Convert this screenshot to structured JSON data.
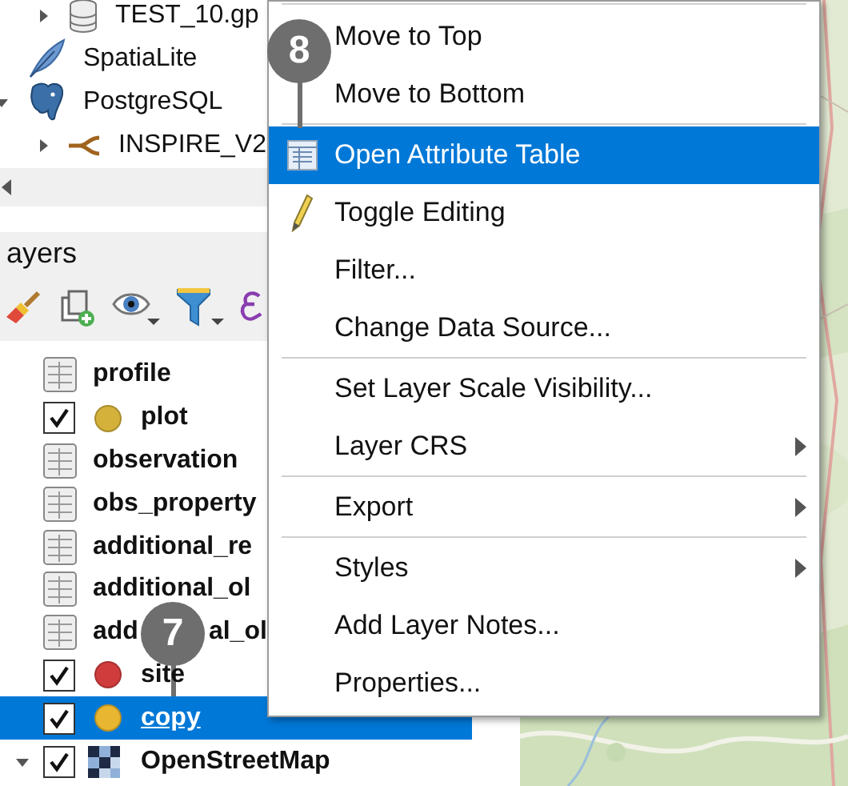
{
  "browser": {
    "continued_children": [
      {
        "label": "TEST_10.gp",
        "kind": "geopackage",
        "expanded": false
      }
    ],
    "items": [
      {
        "label": "SpatiaLite",
        "kind": "spatialite"
      },
      {
        "label": "PostgreSQL",
        "kind": "postgres",
        "expanded": true,
        "children": [
          {
            "label": "INSPIRE_V2",
            "kind": "schema",
            "expanded": false
          }
        ]
      }
    ]
  },
  "layers_panel": {
    "title": "ayers",
    "layers": [
      {
        "label": "profile",
        "kind": "table",
        "selected": false
      },
      {
        "label": "plot",
        "kind": "point",
        "checked": true,
        "color": "#d4b13a",
        "selected": false
      },
      {
        "label": "observation",
        "kind": "table",
        "selected": false
      },
      {
        "label": "obs_property",
        "kind": "table",
        "selected": false
      },
      {
        "label": "additional_re",
        "kind": "table",
        "selected": false
      },
      {
        "label": "additional_ol",
        "kind": "table",
        "selected": false
      },
      {
        "label": "add",
        "label_after_callout": "al_ol",
        "kind": "table",
        "selected": false
      },
      {
        "label": "site",
        "kind": "point",
        "checked": true,
        "color": "#d03c3c",
        "selected": false
      },
      {
        "label": "copy",
        "kind": "point",
        "checked": true,
        "color": "#e8b630",
        "selected": true
      },
      {
        "label": "OpenStreetMap",
        "kind": "raster",
        "checked": true,
        "expanded": true,
        "selected": false
      }
    ]
  },
  "context_menu": {
    "groups": [
      [
        {
          "label": "Move to Top",
          "kind": "plain",
          "selected": false
        },
        {
          "label": "Move to Bottom",
          "kind": "plain",
          "selected": false
        }
      ],
      [
        {
          "label": "Open Attribute Table",
          "kind": "attribute-table",
          "selected": true
        },
        {
          "label": "Toggle Editing",
          "kind": "editing",
          "selected": false
        },
        {
          "label": "Filter...",
          "kind": "plain",
          "selected": false
        },
        {
          "label": "Change Data Source...",
          "kind": "plain",
          "selected": false
        }
      ],
      [
        {
          "label": "Set Layer Scale Visibility...",
          "kind": "plain",
          "selected": false
        },
        {
          "label": "Layer CRS",
          "kind": "plain",
          "submenu": true,
          "selected": false
        }
      ],
      [
        {
          "label": "Export",
          "kind": "plain",
          "submenu": true,
          "selected": false
        }
      ],
      [
        {
          "label": "Styles",
          "kind": "plain",
          "submenu": true,
          "selected": false
        },
        {
          "label": "Add Layer Notes...",
          "kind": "plain",
          "selected": false
        },
        {
          "label": "Properties...",
          "kind": "plain",
          "selected": false
        }
      ]
    ]
  },
  "callouts": [
    {
      "label": "8"
    },
    {
      "label": "7"
    }
  ]
}
